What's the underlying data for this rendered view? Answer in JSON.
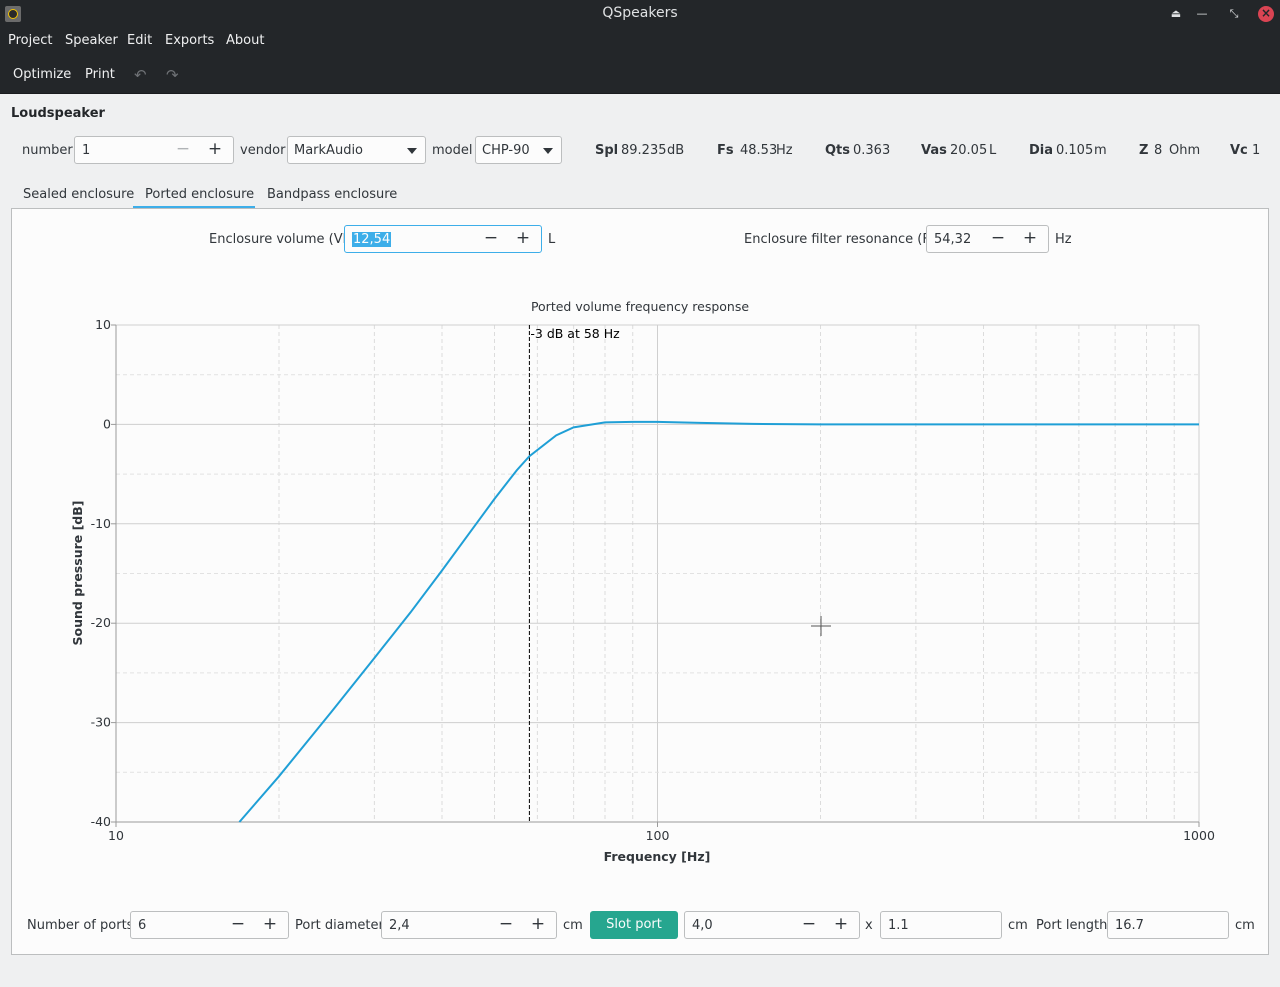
{
  "window": {
    "title": "QSpeakers"
  },
  "menu": [
    "Project",
    "Speaker",
    "Edit",
    "Exports",
    "About"
  ],
  "toolbar": {
    "optimize": "Optimize",
    "print": "Print"
  },
  "loudspeaker": {
    "section_title": "Loudspeaker",
    "number_label": "number",
    "number_value": "1",
    "vendor_label": "vendor",
    "vendor_value": "MarkAudio",
    "model_label": "model",
    "model_value": "CHP-90",
    "params": [
      {
        "name": "Spl",
        "value": "89.235",
        "unit": "dB"
      },
      {
        "name": "Fs",
        "value": "48.53",
        "unit": "Hz"
      },
      {
        "name": "Qts",
        "value": "0.363",
        "unit": ""
      },
      {
        "name": "Vas",
        "value": "20.05",
        "unit": "L"
      },
      {
        "name": "Dia",
        "value": "0.105",
        "unit": "m"
      },
      {
        "name": "Z",
        "value": "8",
        "unit": "Ohm"
      },
      {
        "name": "Vc",
        "value": "1",
        "unit": ""
      }
    ]
  },
  "tabs": [
    "Sealed enclosure",
    "Ported enclosure",
    "Bandpass enclosure"
  ],
  "active_tab": "Ported enclosure",
  "enclosure": {
    "volume_label": "Enclosure volume (Vb)",
    "volume_value": "12,54",
    "volume_unit": "L",
    "fb_label": "Enclosure filter resonance (Fb)",
    "fb_value": "54,32",
    "fb_unit": "Hz"
  },
  "ports": {
    "number_label": "Number of ports",
    "number_value": "6",
    "diameter_label": "Port diameter",
    "diameter_value": "2,4",
    "diameter_unit": "cm",
    "slot_button": "Slot port",
    "slot_width": "4,0",
    "times": "x",
    "slot_height": "1.1",
    "slot_unit": "cm",
    "length_label": "Port length",
    "length_value": "16.7",
    "length_unit": "cm"
  },
  "colors": {
    "accent": "#3daee9",
    "slot_button": "#26a68f",
    "curve": "#1f9fd6",
    "dark_bar": "#232629"
  },
  "chart_data": {
    "type": "line",
    "title": "Ported volume frequency response",
    "xlabel": "Frequency [Hz]",
    "ylabel": "Sound pressure [dB]",
    "xscale": "log",
    "xlim": [
      10,
      1000
    ],
    "ylim": [
      -40,
      10
    ],
    "xticks": [
      "10",
      "100",
      "1000"
    ],
    "yticks": [
      "10",
      "0",
      "-10",
      "-20",
      "-30",
      "-40"
    ],
    "grid": true,
    "marker": {
      "x": 58,
      "label": "-3 dB at 58 Hz"
    },
    "series": [
      {
        "x": [
          16.9,
          20,
          25,
          30,
          35,
          40,
          45,
          50,
          55,
          58,
          65,
          70,
          80,
          90,
          100,
          120,
          150,
          200,
          300,
          500,
          1000
        ],
        "y": [
          -40,
          -35.4,
          -28.9,
          -23.5,
          -18.9,
          -14.7,
          -10.9,
          -7.5,
          -4.6,
          -3.2,
          -1.1,
          -0.3,
          0.2,
          0.25,
          0.25,
          0.15,
          0.05,
          0,
          0,
          0,
          0
        ]
      }
    ]
  }
}
